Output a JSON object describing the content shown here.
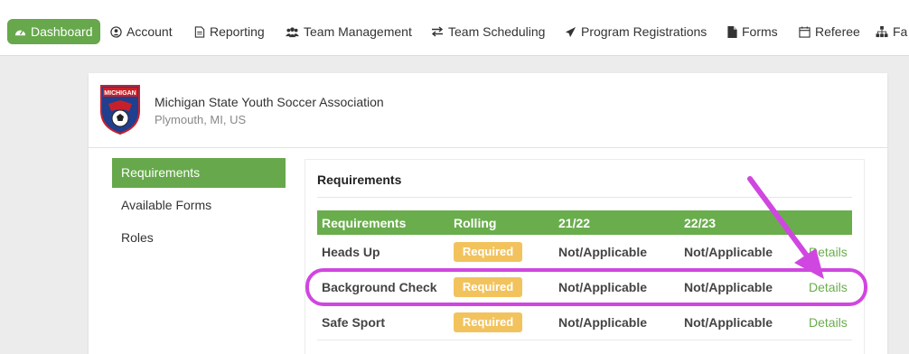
{
  "nav": {
    "items": [
      {
        "label": "Dashboard",
        "icon": "dashboard-icon"
      },
      {
        "label": "Account",
        "icon": "account-icon"
      },
      {
        "label": "Reporting",
        "icon": "document-icon"
      },
      {
        "label": "Team Management",
        "icon": "users-icon"
      },
      {
        "label": "Team Scheduling",
        "icon": "swap-icon"
      },
      {
        "label": "Program Registrations",
        "icon": "send-icon"
      },
      {
        "label": "Forms",
        "icon": "file-icon"
      },
      {
        "label": "Referee",
        "icon": "calendar-icon"
      },
      {
        "label": "Fa",
        "icon": "sitemap-icon"
      }
    ]
  },
  "org": {
    "logo_text": "MICHIGAN",
    "name": "Michigan State Youth Soccer Association",
    "location": "Plymouth, MI, US"
  },
  "sidebar": {
    "items": [
      {
        "label": "Requirements"
      },
      {
        "label": "Available Forms"
      },
      {
        "label": "Roles"
      }
    ]
  },
  "panel": {
    "title": "Requirements",
    "columns": [
      "Requirements",
      "Rolling",
      "21/22",
      "22/23"
    ],
    "rows": [
      {
        "name": "Heads Up",
        "rolling": "Required",
        "y2122": "Not/Applicable",
        "y2223": "Not/Applicable",
        "action": "Details"
      },
      {
        "name": "Background Check",
        "rolling": "Required",
        "y2122": "Not/Applicable",
        "y2223": "Not/Applicable",
        "action": "Details"
      },
      {
        "name": "Safe Sport",
        "rolling": "Required",
        "y2122": "Not/Applicable",
        "y2223": "Not/Applicable",
        "action": "Details"
      }
    ]
  },
  "colors": {
    "accent_green": "#66a84b",
    "badge_yellow": "#f2c35d",
    "annotation_magenta": "#d046e0"
  }
}
